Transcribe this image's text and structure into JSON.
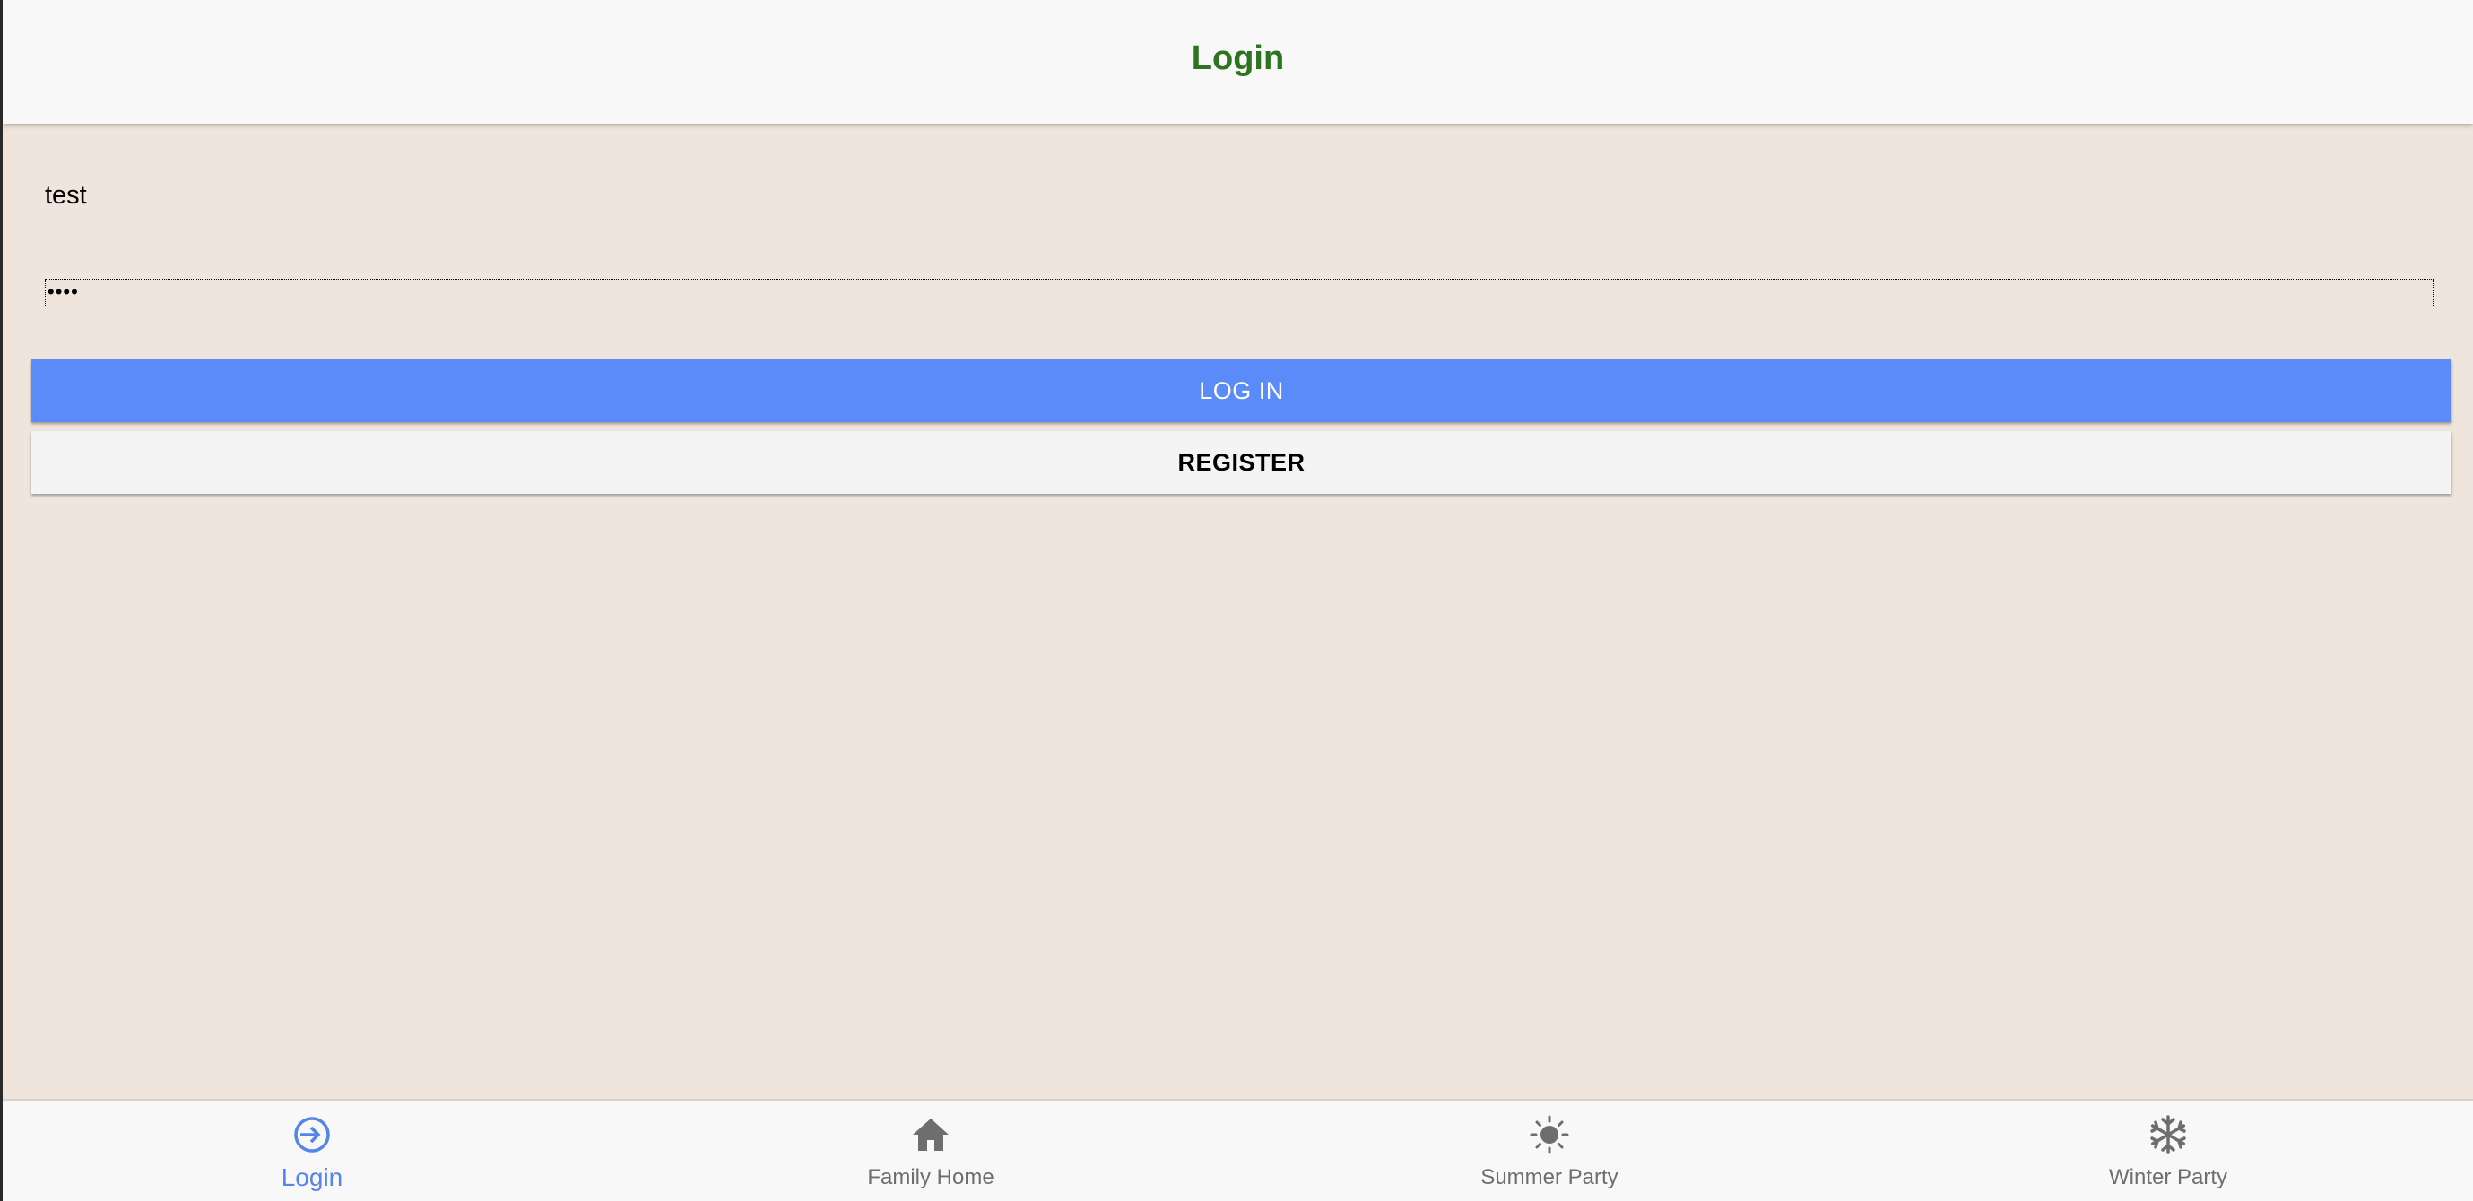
{
  "header": {
    "title": "Login",
    "title_color": "#2E7320"
  },
  "form": {
    "username_value": "test",
    "password_value": "••••"
  },
  "actions": {
    "login_label": "LOG IN",
    "register_label": "REGISTER",
    "login_color": "#5A8BF9"
  },
  "bottom_nav": {
    "items": [
      {
        "label": "Login",
        "icon": "login-icon",
        "active": true
      },
      {
        "label": "Family Home",
        "icon": "home-icon",
        "active": false
      },
      {
        "label": "Summer Party",
        "icon": "sun-icon",
        "active": false
      },
      {
        "label": "Winter Party",
        "icon": "snowflake-icon",
        "active": false
      }
    ],
    "active_color": "#5585E8",
    "inactive_color": "#6E6E6E"
  },
  "colors": {
    "page_background": "#EFE5DC",
    "bar_background": "#F8F8F8"
  }
}
